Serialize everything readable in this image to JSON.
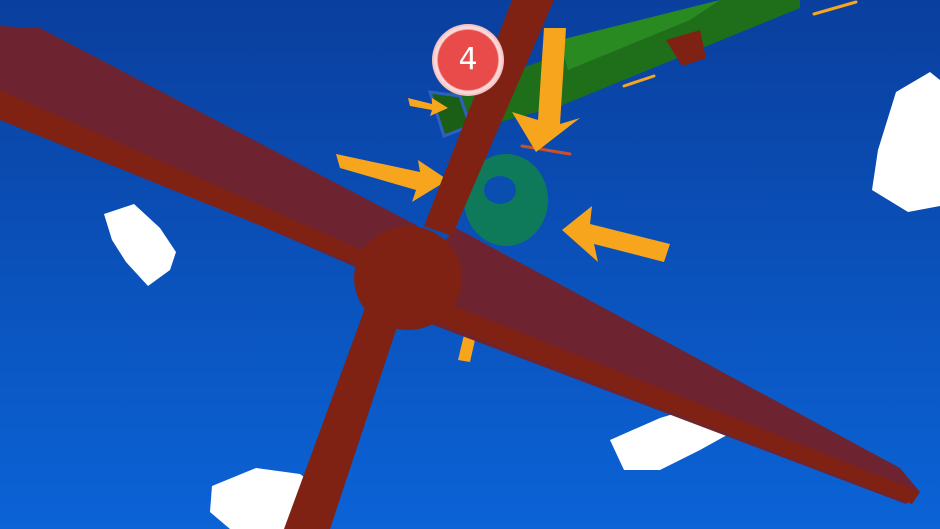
{
  "hud": {
    "checkpoint_number": "4"
  },
  "colors": {
    "sky_top": "#0a3f9e",
    "sky_bottom": "#0b63d6",
    "plane_body": "#7f2214",
    "plane_wing_top": "#6e2430",
    "arrow_orange": "#f7a51c",
    "target_ring_green": "#0f7a5a",
    "checkpoint_green": "#1f6e1a",
    "cloud": "#ffffff",
    "badge_red": "#e94a4a"
  }
}
